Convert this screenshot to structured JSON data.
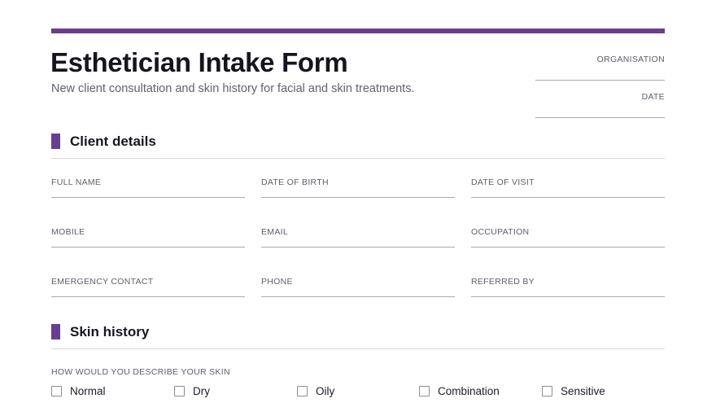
{
  "form": {
    "title": "Esthetician Intake Form",
    "subtitle": "New client consultation and skin history for facial and skin treatments.",
    "accent_color": "#6a3d8f"
  },
  "meta": {
    "organisation_label": "ORGANISATION",
    "date_label": "DATE"
  },
  "client_details": {
    "title": "Client details",
    "fields": [
      "FULL NAME",
      "DATE OF BIRTH",
      "DATE OF VISIT",
      "MOBILE",
      "EMAIL",
      "OCCUPATION",
      "EMERGENCY CONTACT",
      "PHONE",
      "REFERRED BY"
    ]
  },
  "skin_history": {
    "title": "Skin history",
    "question": "HOW WOULD YOU DESCRIBE YOUR SKIN",
    "options": [
      "Normal",
      "Dry",
      "Oily",
      "Combination",
      "Sensitive"
    ]
  }
}
